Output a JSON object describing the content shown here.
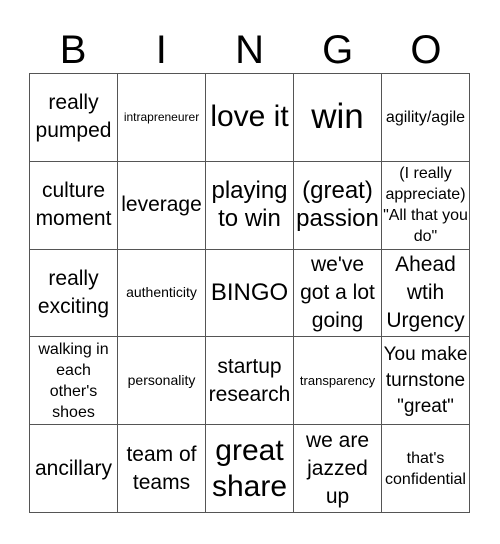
{
  "header": {
    "letters": [
      "B",
      "I",
      "N",
      "G",
      "O"
    ]
  },
  "board": {
    "cells": [
      {
        "text": "really pumped",
        "size": "s-m"
      },
      {
        "text": "intrapreneurer",
        "size": "s-tiny"
      },
      {
        "text": "love it",
        "size": "s-l"
      },
      {
        "text": "win",
        "size": "s-xl"
      },
      {
        "text": "agility/agile",
        "size": "s-s"
      },
      {
        "text": "culture moment",
        "size": "s-m"
      },
      {
        "text": "leverage",
        "size": "s-m"
      },
      {
        "text": "playing to win",
        "size": "s-ml"
      },
      {
        "text": "(great) passion",
        "size": "s-ml"
      },
      {
        "text": "(I really appreciate) \"All that you do\"",
        "size": "s-s"
      },
      {
        "text": "really exciting",
        "size": "s-m"
      },
      {
        "text": "authenticity",
        "size": "s-xs"
      },
      {
        "text": "BINGO",
        "size": "s-ml"
      },
      {
        "text": "we've got a lot going",
        "size": "s-m"
      },
      {
        "text": "Ahead wtih Urgency",
        "size": "s-m"
      },
      {
        "text": "walking in each other's shoes",
        "size": "s-s"
      },
      {
        "text": "personality",
        "size": "s-xs"
      },
      {
        "text": "startup research",
        "size": "s-m"
      },
      {
        "text": "transparency",
        "size": "s-xxs"
      },
      {
        "text": "You make turnstone \"great\"",
        "size": "s-ms"
      },
      {
        "text": "ancillary",
        "size": "s-m"
      },
      {
        "text": "team of teams",
        "size": "s-m"
      },
      {
        "text": "great share",
        "size": "s-l"
      },
      {
        "text": "we are jazzed up",
        "size": "s-m"
      },
      {
        "text": "that's confidential",
        "size": "s-s"
      }
    ]
  }
}
